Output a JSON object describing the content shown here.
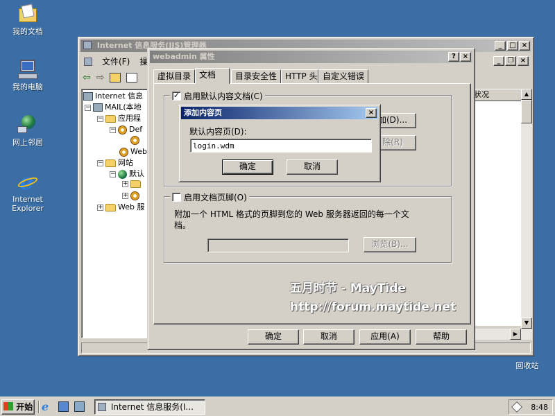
{
  "desktop": {
    "icons": [
      {
        "label": "我的文档",
        "icon": "my-documents-icon"
      },
      {
        "label": "我的电脑",
        "icon": "my-computer-icon"
      },
      {
        "label": "网上邻居",
        "icon": "network-places-icon"
      },
      {
        "label_line1": "Internet",
        "label_line2": "Explorer",
        "icon": "ie-icon"
      }
    ],
    "recycle_bin": "回收站"
  },
  "iis_window": {
    "title": "Internet 信息服务(IIS)管理器",
    "menu": [
      "文件(F)",
      "操"
    ],
    "tree_root": "Internet 信息",
    "tree": [
      {
        "label": "MAIL(本地"
      },
      {
        "label": "应用程"
      },
      {
        "label": "Def"
      },
      {
        "label": ""
      },
      {
        "label": "Web"
      },
      {
        "label": "网站"
      },
      {
        "label": "默认"
      },
      {
        "label": ""
      },
      {
        "label": ""
      },
      {
        "label": "Web 服"
      }
    ],
    "column_status": "状况"
  },
  "props_dialog": {
    "title": "webadmin 属性",
    "help_btn": "?",
    "close_btn": "×",
    "tabs": [
      "虚拟目录",
      "文档",
      "目录安全性",
      "HTTP 头",
      "自定义错误"
    ],
    "enable_default_doc": "启用默认内容文档(C)",
    "add_btn_fragment": "加(D)...",
    "remove_btn_fragment": "除(R)",
    "enable_footer": "启用文档页脚(O)",
    "footer_desc": "附加一个 HTML 格式的页脚到您的 Web 服务器返回的每一个文档。",
    "browse_btn": "浏览(B)...",
    "ok": "确定",
    "cancel": "取消",
    "apply": "应用(A)",
    "help": "帮助"
  },
  "add_dialog": {
    "title": "添加内容页",
    "label": "默认内容页(D):",
    "value": "login.wdm",
    "ok": "确定",
    "cancel": "取消"
  },
  "watermark": {
    "line1": "五月时节 - MayTide",
    "line2": "http://forum.maytide.net"
  },
  "taskbar": {
    "start": "开始",
    "task": "Internet 信息服务(I...",
    "clock": "8:48"
  }
}
